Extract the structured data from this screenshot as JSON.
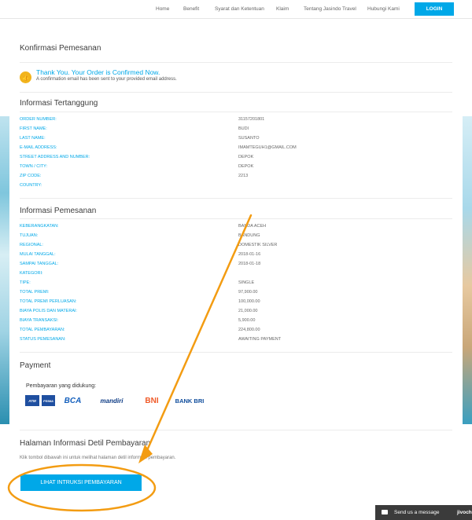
{
  "nav": {
    "items": [
      "Home",
      "Benefit",
      "Syarat dan Ketentuan",
      "Klaim",
      "Tentang Jasindo Travel",
      "Hubungi Kami"
    ],
    "login_label": "LOGIN"
  },
  "confirmation": {
    "title": "Konfirmasi Pemesanan",
    "heading": "Thank You. Your Order is Confirmed Now.",
    "subtext": "A confirmation email has been sent to your provided email address."
  },
  "insured": {
    "title": "Informasi Tertanggung",
    "rows": [
      {
        "label": "ORDER NUMBER:",
        "value": "31157201801"
      },
      {
        "label": "FIRST NAME:",
        "value": "BUDI"
      },
      {
        "label": "LAST NAME:",
        "value": "SUSANTO"
      },
      {
        "label": "E-MAIL ADDRESS:",
        "value": "IMAMTEGUH1@GMAIL.COM"
      },
      {
        "label": "STREET ADDRESS AND NUMBER:",
        "value": "DEPOK"
      },
      {
        "label": "TOWN / CITY:",
        "value": "DEPOK"
      },
      {
        "label": "ZIP CODE:",
        "value": "2213"
      },
      {
        "label": "COUNTRY:",
        "value": ""
      }
    ]
  },
  "order": {
    "title": "Informasi Pemesanan",
    "rows": [
      {
        "label": "KEBERANGKATAN:",
        "value": "BANDA ACEH"
      },
      {
        "label": "TUJUAN:",
        "value": "BANDUNG"
      },
      {
        "label": "REGIONAL:",
        "value": "DOMESTIK SILVER"
      },
      {
        "label": "MULAI TANGGAL:",
        "value": "2018-01-16"
      },
      {
        "label": "SAMPAI TANGGAL:",
        "value": "2018-01-18"
      },
      {
        "label": "KATEGORI:",
        "value": ""
      },
      {
        "label": "TIPE:",
        "value": "SINGLE"
      },
      {
        "label": "TOTAL PREMI:",
        "value": "97,900.00"
      },
      {
        "label": "TOTAL PREMI PERLUASAN:",
        "value": "100,000.00"
      },
      {
        "label": "BIAYA POLIS DAN MATERAI:",
        "value": "21,000.00"
      },
      {
        "label": "BIAYA TRANSAKSI:",
        "value": "5,900.00"
      },
      {
        "label": "TOTAL PEMBAYARAN:",
        "value": "224,800.00"
      },
      {
        "label": "STATUS PEMESANAN:",
        "value": "AWAITING PAYMENT"
      }
    ]
  },
  "payment": {
    "title": "Payment",
    "supported_label": "Pembayaran yang didukung:",
    "banks": [
      "ATM",
      "PRIMA",
      "BCA",
      "mandiri",
      "BNI",
      "BANK BRI"
    ]
  },
  "payment_detail": {
    "title": "Halaman Informasi Detil Pembayaran",
    "note": "Klik tombol dibawah ini untuk melihat halaman detil informasi pembayaran.",
    "button_label": "LIHAT INTRUKSI PEMBAYARAN"
  },
  "chat": {
    "label": "Send us a message",
    "brand": "jivochat"
  },
  "colors": {
    "accent": "#00a8e8",
    "annotation": "#f39c12"
  }
}
